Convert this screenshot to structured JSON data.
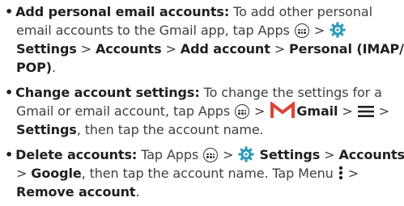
{
  "items": [
    {
      "bullet": "•",
      "l1_title": "Add personal email accounts:",
      "l1_text": " To add other personal",
      "l2_text": "email accounts to the Gmail app, tap Apps",
      "l2_sep": " > ",
      "l3_settings": "Settings",
      "l3_sep1": " > ",
      "l3_accounts": "Accounts",
      "l3_sep2": " > ",
      "l3_add": "Add account",
      "l3_sep3": " > ",
      "l3_personal": "Personal (IMAP/",
      "l4_pop": "POP)",
      "l4_end": "."
    },
    {
      "bullet": "•",
      "l1_title": "Change account settings:",
      "l1_text": " To change the settings for a",
      "l2_text": "Gmail or email account, tap Apps",
      "l2_sep1": " > ",
      "l2_gmail": "Gmail",
      "l2_sep2": " > ",
      "l2_sep3": " >",
      "l3_settings": "Settings",
      "l3_text": ", then tap the account name."
    },
    {
      "bullet": "•",
      "l1_title": "Delete accounts:",
      "l1_text": " Tap Apps",
      "l1_sep1": " > ",
      "l1_settings": "Settings",
      "l1_sep2": " > ",
      "l1_accounts": "Accounts",
      "l2_sep": ">  ",
      "l2_google": "Google",
      "l2_text": ", then tap the account name. Tap Menu",
      "l2_sep2": " >",
      "l3_remove": "Remove account",
      "l3_end": "."
    }
  ],
  "icons": {
    "apps": "apps-icon",
    "settings": "gear-icon",
    "gmail": "gmail-icon",
    "menu": "menu-icon",
    "more": "kebab-icon"
  },
  "colors": {
    "text": "#3f3f3f",
    "bold": "#1f1f1f",
    "gear": "#2f9ab8",
    "gmail_red": "#db4437"
  }
}
